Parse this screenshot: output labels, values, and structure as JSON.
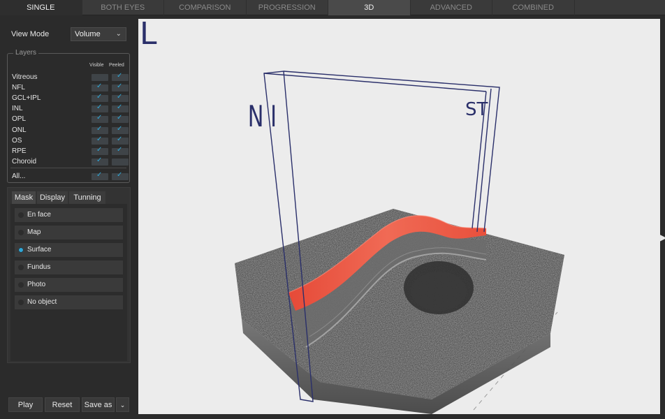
{
  "tabs": [
    "SINGLE",
    "BOTH EYES",
    "COMPARISON",
    "PROGRESSION",
    "3D",
    "ADVANCED",
    "COMBINED"
  ],
  "active_tab": "3D",
  "view_mode": {
    "label": "View Mode",
    "value": "Volume"
  },
  "layers": {
    "title": "Layers",
    "col_visible": "Visible",
    "col_peeled": "Peeled",
    "items": [
      {
        "name": "Vitreous",
        "visible": false,
        "peeled": true
      },
      {
        "name": "NFL",
        "visible": true,
        "peeled": true
      },
      {
        "name": "GCL+IPL",
        "visible": true,
        "peeled": true
      },
      {
        "name": "INL",
        "visible": true,
        "peeled": true
      },
      {
        "name": "OPL",
        "visible": true,
        "peeled": true
      },
      {
        "name": "ONL",
        "visible": true,
        "peeled": true
      },
      {
        "name": "OS",
        "visible": true,
        "peeled": true
      },
      {
        "name": "RPE",
        "visible": true,
        "peeled": true
      },
      {
        "name": "Choroid",
        "visible": true,
        "peeled": false
      }
    ],
    "all_label": "All..."
  },
  "mask_tabs": [
    "Mask",
    "Display",
    "Tunning"
  ],
  "mask_options": [
    {
      "label": "En face",
      "selected": false
    },
    {
      "label": "Map",
      "selected": false
    },
    {
      "label": "Surface",
      "selected": true
    },
    {
      "label": "Fundus",
      "selected": false
    },
    {
      "label": "Photo",
      "selected": false
    },
    {
      "label": "No object",
      "selected": false
    }
  ],
  "buttons": {
    "play": "Play",
    "reset": "Reset",
    "save_as": "Save as"
  },
  "viewport": {
    "eye": "L",
    "axis_left": "N I",
    "axis_right": "ST"
  },
  "colors": {
    "accent": "#2fa7d8",
    "surface": "#e8503c",
    "box": "#2a2f6a"
  }
}
